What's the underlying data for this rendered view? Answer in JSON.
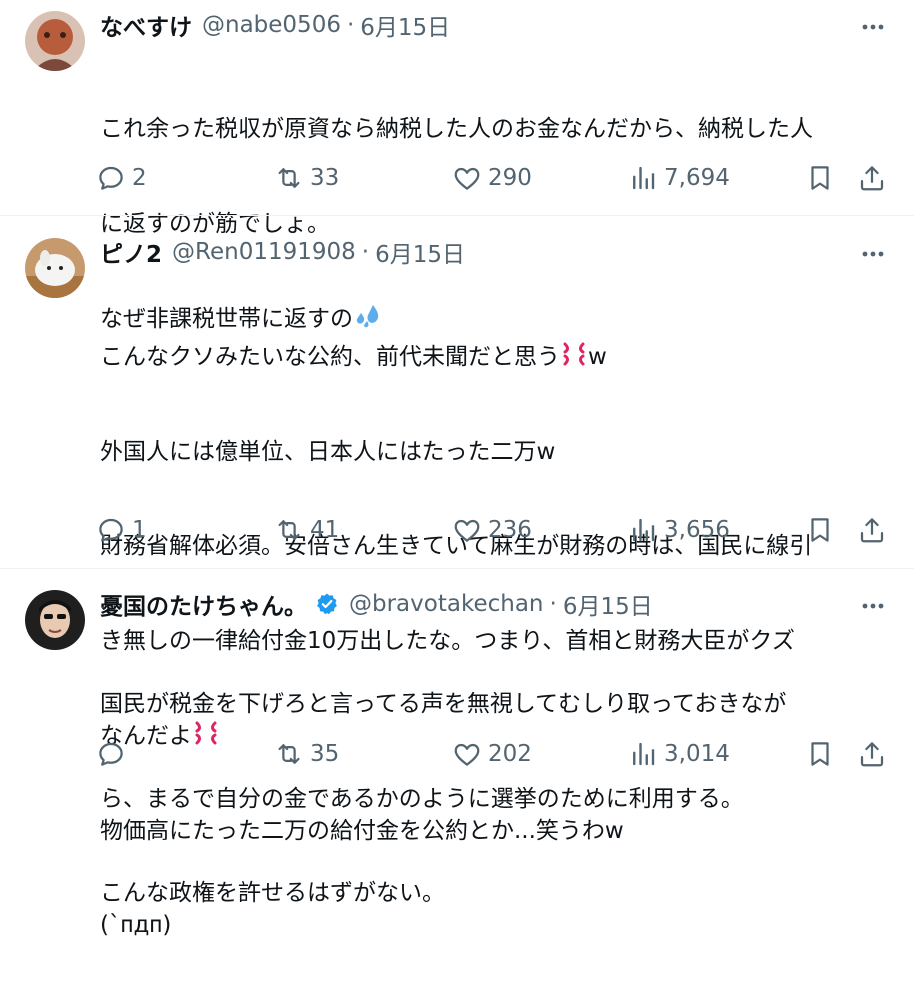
{
  "tweets": [
    {
      "name": "なべすけ",
      "handle": "@nabe0506",
      "separator": "·",
      "date": "6月15日",
      "verified": false,
      "lines": [
        "これ余った税収が原資なら納税した人のお金なんだから、納税した人",
        "に返すのが筋でしょ。",
        "なぜ非課税世帯に返すの"
      ],
      "emoji_after_line": {
        "line": 2,
        "emoji": "sweat-droplets-emoji"
      },
      "stats": {
        "replies": "2",
        "retweets": "33",
        "likes": "290",
        "views": "7,694"
      }
    },
    {
      "name": "ピノ2",
      "handle": "@Ren01191908",
      "separator": "·",
      "date": "6月15日",
      "verified": false,
      "lines": [
        "こんなクソみたいな公約、前代未聞だと思う",
        "外国人には億単位、日本人にはたった二万w",
        "財務省解体必須。安倍さん生きていて麻生が財務の時は、国民に線引",
        "き無しの一律給付金10万出したな。つまり、首相と財務大臣がクズ",
        "なんだよ",
        "物価高にたった二万の給付金を公約とか...笑うわw",
        "(`ᴨдᴨ)"
      ],
      "line0_suffix": "w",
      "emoji_names": [
        "anger-symbol-emoji",
        "anger-symbol-emoji"
      ],
      "stats": {
        "replies": "1",
        "retweets": "41",
        "likes": "236",
        "views": "3,656"
      }
    },
    {
      "name": "憂国のたけちゃん。",
      "handle": "@bravotakechan",
      "separator": "·",
      "date": "6月15日",
      "verified": true,
      "lines": [
        "国民が税金を下げろと言ってる声を無視してむしり取っておきなが",
        "ら、まるで自分の金であるかのように選挙のために利用する。",
        "こんな政権を許せるはずがない。"
      ],
      "stats": {
        "replies": "",
        "retweets": "35",
        "likes": "202",
        "views": "3,014"
      }
    }
  ],
  "colors": {
    "text": "#0f1419",
    "secondary": "#536471",
    "divider": "#eff3f4",
    "verified": "#1d9bf0",
    "sweat_emoji": "#5dadec",
    "anger_emoji": "#e0245e"
  },
  "icons": [
    "reply-icon",
    "retweet-icon",
    "like-icon",
    "views-icon",
    "bookmark-icon",
    "share-icon",
    "more-icon",
    "verified-badge-icon"
  ]
}
